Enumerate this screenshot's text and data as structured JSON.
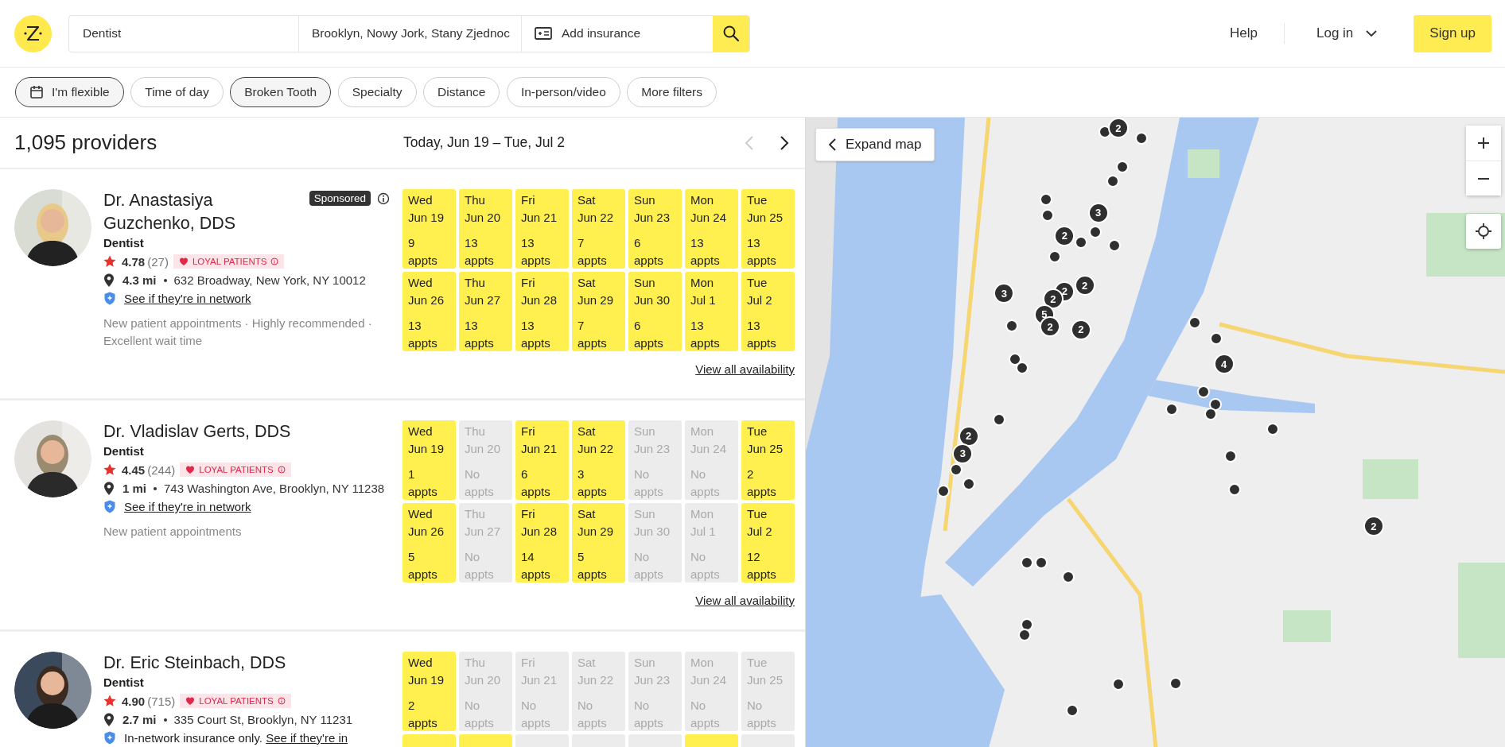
{
  "header": {
    "specialty": "Dentist",
    "location": "Brooklyn, Nowy Jork, Stany Zjednoc",
    "insurance": "Add insurance",
    "help": "Help",
    "login": "Log in",
    "signup": "Sign up"
  },
  "filters": [
    {
      "label": "I'm flexible",
      "selected": true,
      "kind": "calendar"
    },
    {
      "label": "Time of day",
      "selected": false,
      "kind": "plain"
    },
    {
      "label": "Broken Tooth",
      "selected": true,
      "kind": "plain"
    },
    {
      "label": "Specialty",
      "selected": false,
      "kind": "plain"
    },
    {
      "label": "Distance",
      "selected": false,
      "kind": "plain"
    },
    {
      "label": "In-person/video",
      "selected": false,
      "kind": "plain"
    },
    {
      "label": "More filters",
      "selected": false,
      "kind": "plain"
    }
  ],
  "results": {
    "count": "1,095 providers",
    "date_range": "Today, Jun 19 – Tue, Jul 2",
    "prev_disabled": true
  },
  "providers": [
    {
      "name": "Dr. Anastasiya Guzchenko, DDS",
      "sponsored": "Sponsored",
      "specialty": "Dentist",
      "rating": "4.78",
      "reviews": "(27)",
      "badge": "LOYAL PATIENTS",
      "distance": "4.3 mi",
      "address": "632 Broadway, New York, NY 10012",
      "network_link": "See if they're in network",
      "highlights": "New patient appointments · Highly recommended · Excellent wait time",
      "view_all": "View all availability",
      "days": [
        {
          "day": "Wed",
          "date": "Jun 19",
          "count": "9",
          "unit": "appts",
          "available": true
        },
        {
          "day": "Thu",
          "date": "Jun 20",
          "count": "13",
          "unit": "appts",
          "available": true
        },
        {
          "day": "Fri",
          "date": "Jun 21",
          "count": "13",
          "unit": "appts",
          "available": true
        },
        {
          "day": "Sat",
          "date": "Jun 22",
          "count": "7",
          "unit": "appts",
          "available": true
        },
        {
          "day": "Sun",
          "date": "Jun 23",
          "count": "6",
          "unit": "appts",
          "available": true
        },
        {
          "day": "Mon",
          "date": "Jun 24",
          "count": "13",
          "unit": "appts",
          "available": true
        },
        {
          "day": "Tue",
          "date": "Jun 25",
          "count": "13",
          "unit": "appts",
          "available": true
        },
        {
          "day": "Wed",
          "date": "Jun 26",
          "count": "13",
          "unit": "appts",
          "available": true
        },
        {
          "day": "Thu",
          "date": "Jun 27",
          "count": "13",
          "unit": "appts",
          "available": true
        },
        {
          "day": "Fri",
          "date": "Jun 28",
          "count": "13",
          "unit": "appts",
          "available": true
        },
        {
          "day": "Sat",
          "date": "Jun 29",
          "count": "7",
          "unit": "appts",
          "available": true
        },
        {
          "day": "Sun",
          "date": "Jun 30",
          "count": "6",
          "unit": "appts",
          "available": true
        },
        {
          "day": "Mon",
          "date": "Jul 1",
          "count": "13",
          "unit": "appts",
          "available": true
        },
        {
          "day": "Tue",
          "date": "Jul 2",
          "count": "13",
          "unit": "appts",
          "available": true
        }
      ]
    },
    {
      "name": "Dr. Vladislav Gerts, DDS",
      "specialty": "Dentist",
      "rating": "4.45",
      "reviews": "(244)",
      "badge": "LOYAL PATIENTS",
      "distance": "1 mi",
      "address": "743 Washington Ave, Brooklyn, NY 11238",
      "network_link": "See if they're in network",
      "highlights": "New patient appointments",
      "view_all": "View all availability",
      "days": [
        {
          "day": "Wed",
          "date": "Jun 19",
          "count": "1",
          "unit": "appts",
          "available": true
        },
        {
          "day": "Thu",
          "date": "Jun 20",
          "count": "No",
          "unit": "appts",
          "available": false
        },
        {
          "day": "Fri",
          "date": "Jun 21",
          "count": "6",
          "unit": "appts",
          "available": true
        },
        {
          "day": "Sat",
          "date": "Jun 22",
          "count": "3",
          "unit": "appts",
          "available": true
        },
        {
          "day": "Sun",
          "date": "Jun 23",
          "count": "No",
          "unit": "appts",
          "available": false
        },
        {
          "day": "Mon",
          "date": "Jun 24",
          "count": "No",
          "unit": "appts",
          "available": false
        },
        {
          "day": "Tue",
          "date": "Jun 25",
          "count": "2",
          "unit": "appts",
          "available": true
        },
        {
          "day": "Wed",
          "date": "Jun 26",
          "count": "5",
          "unit": "appts",
          "available": true
        },
        {
          "day": "Thu",
          "date": "Jun 27",
          "count": "No",
          "unit": "appts",
          "available": false
        },
        {
          "day": "Fri",
          "date": "Jun 28",
          "count": "14",
          "unit": "appts",
          "available": true
        },
        {
          "day": "Sat",
          "date": "Jun 29",
          "count": "5",
          "unit": "appts",
          "available": true
        },
        {
          "day": "Sun",
          "date": "Jun 30",
          "count": "No",
          "unit": "appts",
          "available": false
        },
        {
          "day": "Mon",
          "date": "Jul 1",
          "count": "No",
          "unit": "appts",
          "available": false
        },
        {
          "day": "Tue",
          "date": "Jul 2",
          "count": "12",
          "unit": "appts",
          "available": true
        }
      ]
    },
    {
      "name": "Dr. Eric Steinbach, DDS",
      "specialty": "Dentist",
      "rating": "4.90",
      "reviews": "(715)",
      "badge": "LOYAL PATIENTS",
      "distance": "2.7 mi",
      "address": "335 Court St, Brooklyn, NY 11231",
      "network_note": "In-network insurance only.",
      "network_link": "See if they're in",
      "days": [
        {
          "day": "Wed",
          "date": "Jun 19",
          "count": "2",
          "unit": "appts",
          "available": true
        },
        {
          "day": "Thu",
          "date": "Jun 20",
          "count": "No",
          "unit": "appts",
          "available": false
        },
        {
          "day": "Fri",
          "date": "Jun 21",
          "count": "No",
          "unit": "appts",
          "available": false
        },
        {
          "day": "Sat",
          "date": "Jun 22",
          "count": "No",
          "unit": "appts",
          "available": false
        },
        {
          "day": "Sun",
          "date": "Jun 23",
          "count": "No",
          "unit": "appts",
          "available": false
        },
        {
          "day": "Mon",
          "date": "Jun 24",
          "count": "No",
          "unit": "appts",
          "available": false
        },
        {
          "day": "Tue",
          "date": "Jun 25",
          "count": "No",
          "unit": "appts",
          "available": false
        },
        {
          "available": true
        },
        {
          "available": true
        },
        {
          "available": false
        },
        {
          "available": false
        },
        {
          "available": false
        },
        {
          "available": true
        },
        {
          "available": false
        }
      ]
    }
  ],
  "map": {
    "expand": "Expand map",
    "clusters": [
      {
        "count": "2"
      },
      {
        "count": "3"
      },
      {
        "count": "2"
      },
      {
        "count": "2"
      },
      {
        "count": "2"
      },
      {
        "count": "2"
      },
      {
        "count": "3"
      },
      {
        "count": "5"
      },
      {
        "count": "2"
      },
      {
        "count": "2"
      },
      {
        "count": "4"
      },
      {
        "count": "2"
      },
      {
        "count": "3"
      },
      {
        "count": "2"
      }
    ]
  }
}
